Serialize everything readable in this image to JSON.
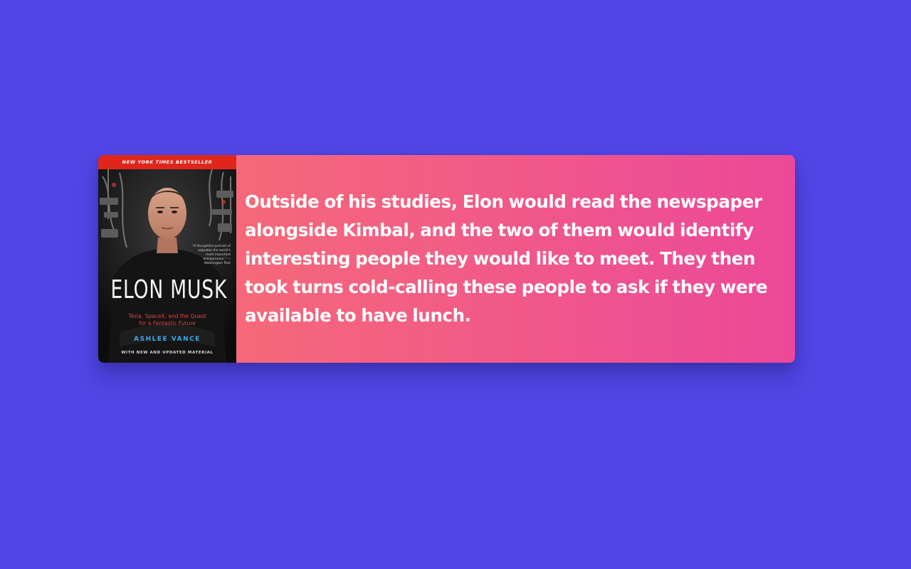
{
  "card": {
    "book": {
      "banner": "NEW YORK TIMES BESTSELLER",
      "title": "ELON MUSK",
      "subtitle": "Tesla, SpaceX, and the Quest\nfor a Fantastic Future",
      "author": "ASHLEE VANCE",
      "footer": "WITH NEW AND UPDATED MATERIAL",
      "blurb": "\"A thoughtful portrait of arguably the world's most important entrepreneur.\" —Washington Post"
    },
    "quote": "Outside of his studies, Elon would read the newspaper alongside Kimbal, and the two of them would identify interesting people they would like to meet. They then took turns cold-calling these people to ask if they were available to have lunch."
  },
  "colors": {
    "background": "#4f46e5",
    "card_gradient_start": "#f87171",
    "card_gradient_end": "#ec4899",
    "quote_text": "#ffffff",
    "cover_banner": "#e0261b"
  }
}
